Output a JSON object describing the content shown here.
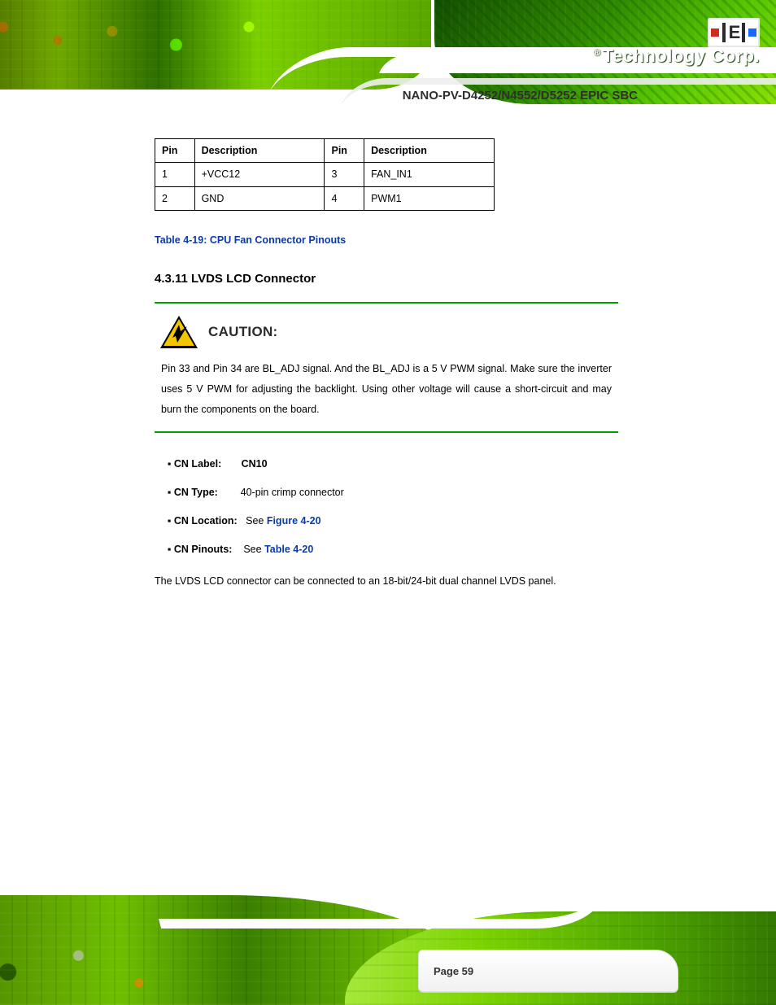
{
  "brand": {
    "text": "Technology Corp.",
    "registered": "®"
  },
  "doc_title": "NANO-PV-D4252/N4552/D5252 EPIC SBC",
  "pin_table": {
    "headers": [
      "Pin",
      "Description",
      "Pin",
      "Description"
    ],
    "rows": [
      [
        "1",
        "+VCC12",
        "3",
        "FAN_IN1"
      ],
      [
        "2",
        "GND",
        "4",
        "PWM1"
      ]
    ],
    "caption_label": "Table 4-19: CPU Fan Connector Pinouts",
    "caption_prefix": "Table 4-19: ",
    "caption_body": "CPU Fan Connector Pinouts"
  },
  "section": {
    "number": "4.3.11 ",
    "title": "LVDS LCD Connector"
  },
  "caution": {
    "label": "CAUTION:",
    "body": "Pin 33 and Pin 34 are BL_ADJ signal. And the BL_ADJ is a 5 V PWM signal. Make sure the inverter uses 5 V PWM for adjusting the backlight. Using other voltage will cause a short-circuit and may burn the components on the board."
  },
  "body": {
    "cn_label_a": "CN Label:",
    "cn_label_b": "CN10",
    "cn_type_a": "CN Type:",
    "cn_type_b": "40-pin crimp connector",
    "cn_loc_a": "CN Location:",
    "cn_loc_b": "See ",
    "cn_loc_ref": "Figure 4-20",
    "cn_pin_a": "CN Pinouts:",
    "cn_pin_b": "See ",
    "cn_pin_ref": "Table 4-20",
    "desc": "The LVDS LCD connector can be connected to an 18-bit/24-bit dual channel LVDS panel."
  },
  "page": "Page 59"
}
